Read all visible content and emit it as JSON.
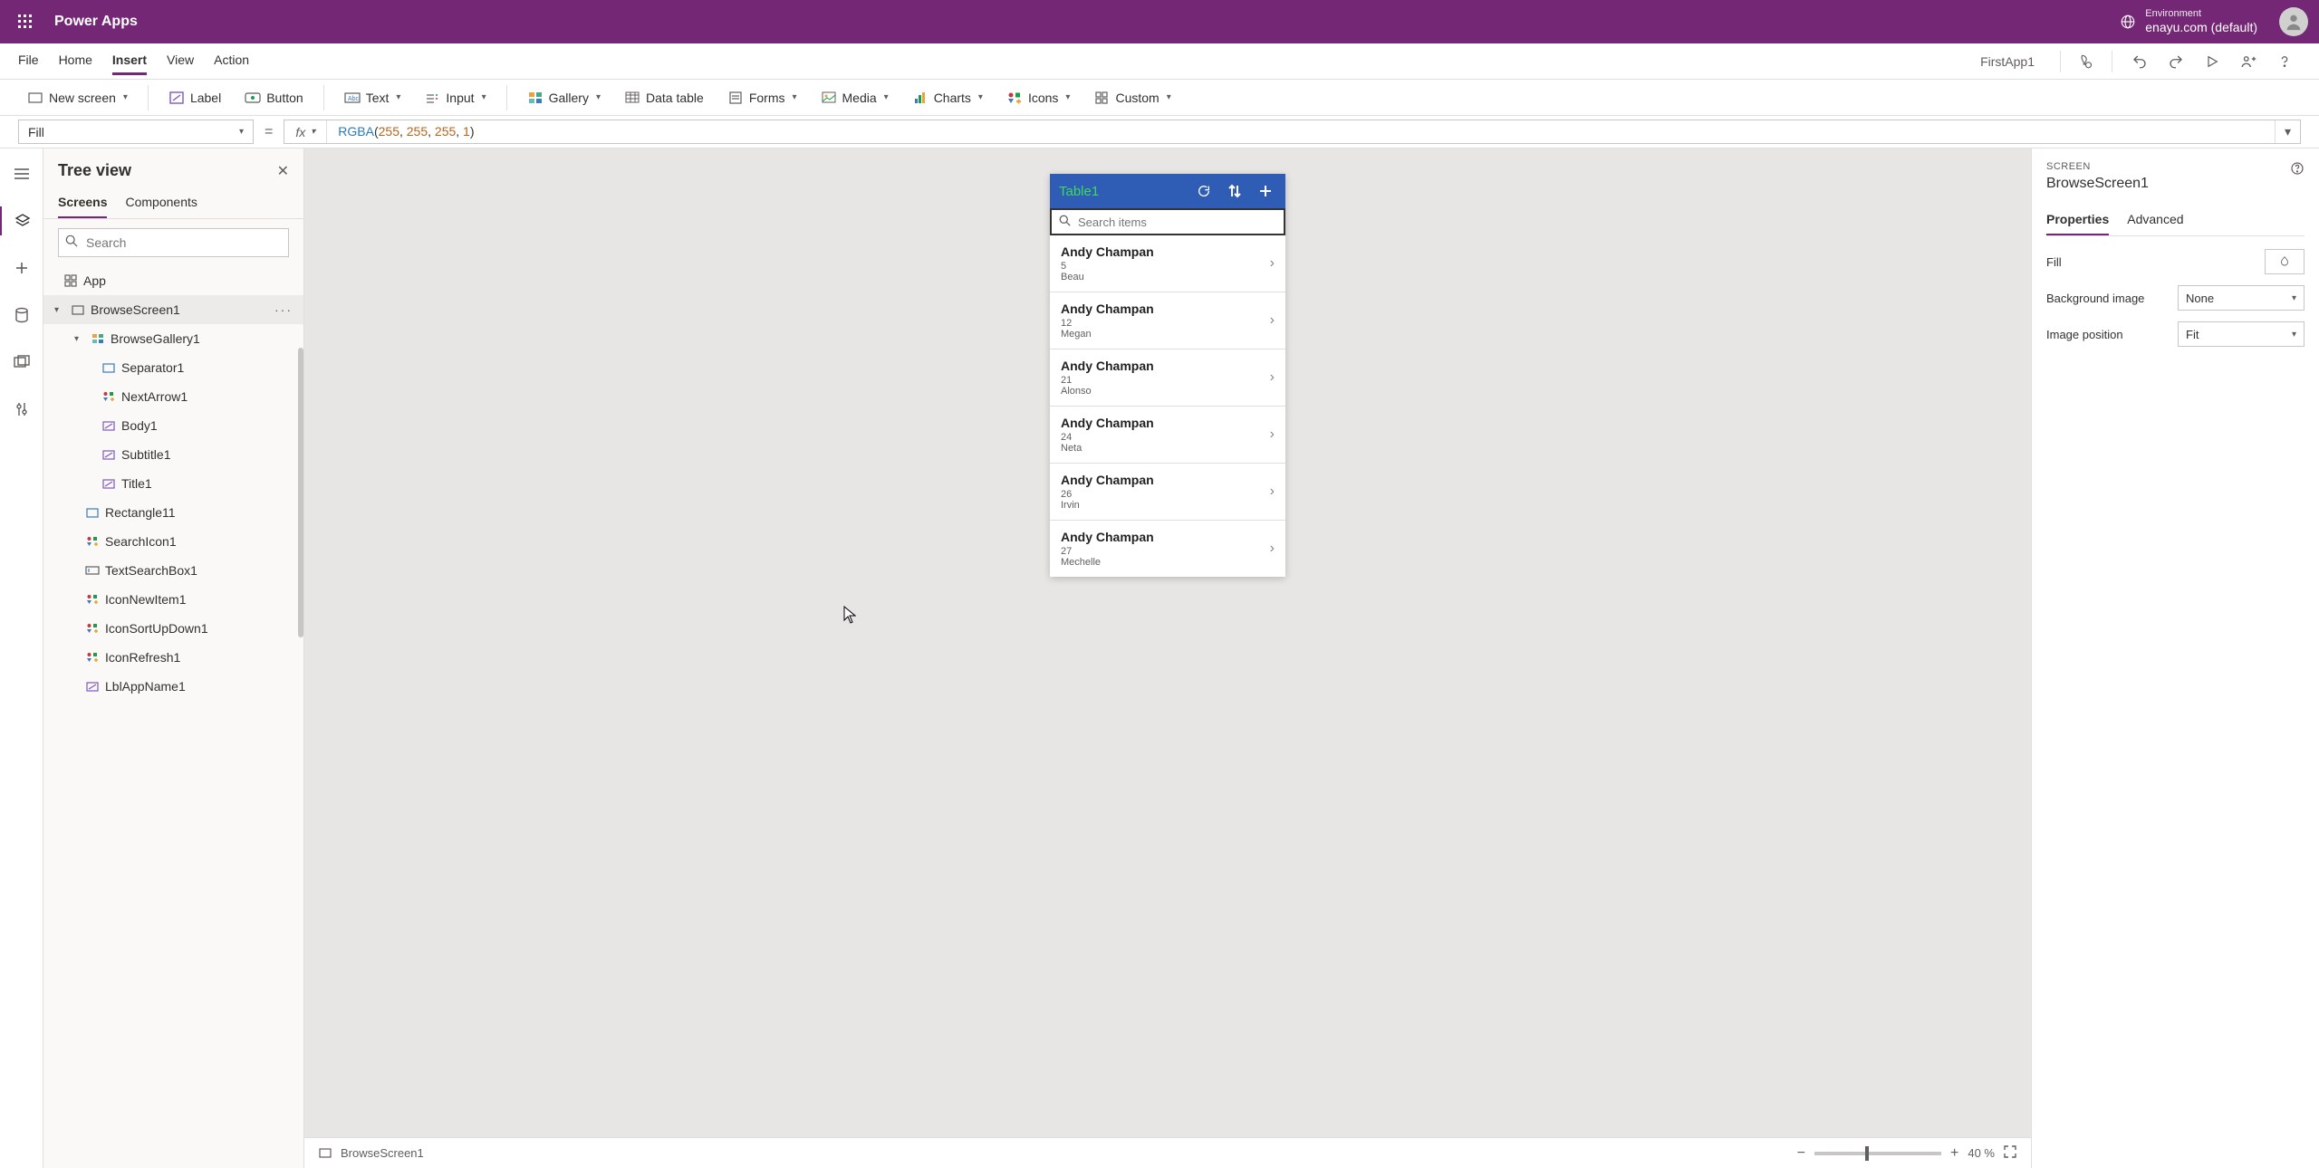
{
  "titlebar": {
    "app_title": "Power Apps",
    "env_label": "Environment",
    "env_name": "enayu.com (default)"
  },
  "menubar": {
    "items": [
      "File",
      "Home",
      "Insert",
      "View",
      "Action"
    ],
    "active_index": 2,
    "app_name": "FirstApp1"
  },
  "ribbon": {
    "new_screen": "New screen",
    "label": "Label",
    "button": "Button",
    "text": "Text",
    "input": "Input",
    "gallery": "Gallery",
    "data_table": "Data table",
    "forms": "Forms",
    "media": "Media",
    "charts": "Charts",
    "icons": "Icons",
    "custom": "Custom"
  },
  "formula": {
    "property": "Fill",
    "fx_label": "fx",
    "fn": "RGBA",
    "args": [
      "255",
      "255",
      "255",
      "1"
    ]
  },
  "tree": {
    "title": "Tree view",
    "tabs": [
      "Screens",
      "Components"
    ],
    "active_tab": 0,
    "search_placeholder": "Search",
    "nodes": {
      "app": "App",
      "browse_screen": "BrowseScreen1",
      "browse_gallery": "BrowseGallery1",
      "separator": "Separator1",
      "next_arrow": "NextArrow1",
      "body": "Body1",
      "subtitle": "Subtitle1",
      "title": "Title1",
      "rectangle": "Rectangle11",
      "search_icon": "SearchIcon1",
      "text_searchbox": "TextSearchBox1",
      "icon_new_item": "IconNewItem1",
      "icon_sort": "IconSortUpDown1",
      "icon_refresh": "IconRefresh1",
      "lbl_app_name": "LblAppName1"
    }
  },
  "preview": {
    "header_title": "Table1",
    "search_placeholder": "Search items",
    "items": [
      {
        "title": "Andy Champan",
        "subtitle": "5",
        "body": "Beau"
      },
      {
        "title": "Andy Champan",
        "subtitle": "12",
        "body": "Megan"
      },
      {
        "title": "Andy Champan",
        "subtitle": "21",
        "body": "Alonso"
      },
      {
        "title": "Andy Champan",
        "subtitle": "24",
        "body": "Neta"
      },
      {
        "title": "Andy Champan",
        "subtitle": "26",
        "body": "Irvin"
      },
      {
        "title": "Andy Champan",
        "subtitle": "27",
        "body": "Mechelle"
      }
    ]
  },
  "canvas_footer": {
    "screen_name": "BrowseScreen1",
    "zoom_label": "40  %"
  },
  "props": {
    "type_label": "SCREEN",
    "name": "BrowseScreen1",
    "tabs": [
      "Properties",
      "Advanced"
    ],
    "active_tab": 0,
    "rows": {
      "fill_label": "Fill",
      "bg_label": "Background image",
      "bg_value": "None",
      "pos_label": "Image position",
      "pos_value": "Fit"
    }
  }
}
